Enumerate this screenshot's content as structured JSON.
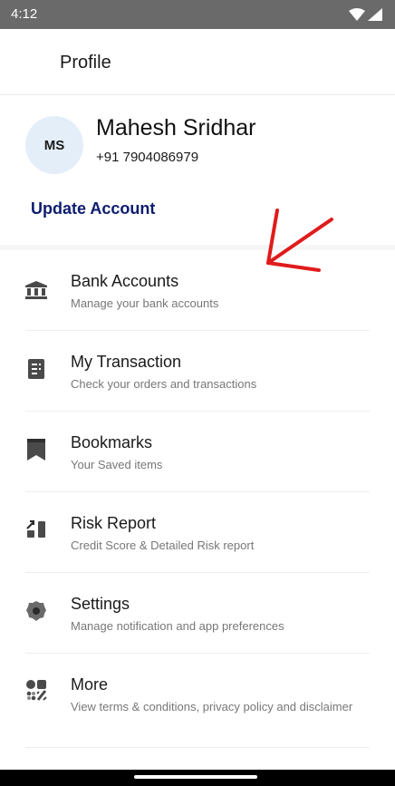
{
  "status_bar": {
    "time": "4:12"
  },
  "header": {
    "title": "Profile"
  },
  "profile": {
    "initials": "MS",
    "name": "Mahesh Sridhar",
    "phone": "+91 7904086979",
    "update_label": "Update Account"
  },
  "annotation": {
    "color": "#e01b1b"
  },
  "menu": {
    "items": [
      {
        "title": "Bank Accounts",
        "subtitle": "Manage your bank accounts",
        "icon": "bank-icon"
      },
      {
        "title": "My Transaction",
        "subtitle": "Check your orders and transactions",
        "icon": "receipt-icon"
      },
      {
        "title": "Bookmarks",
        "subtitle": "Your Saved items",
        "icon": "bookmark-icon"
      },
      {
        "title": "Risk Report",
        "subtitle": "Credit Score & Detailed Risk report",
        "icon": "chart-icon"
      },
      {
        "title": "Settings",
        "subtitle": "Manage notification and app preferences",
        "icon": "gear-icon"
      },
      {
        "title": "More",
        "subtitle": "View terms & conditions, privacy policy and disclaimer",
        "icon": "grid-icon"
      }
    ]
  },
  "colors": {
    "accent": "#0d1c6e",
    "icon": "#4a4a4a",
    "status_bar": "#6a6a6a"
  }
}
